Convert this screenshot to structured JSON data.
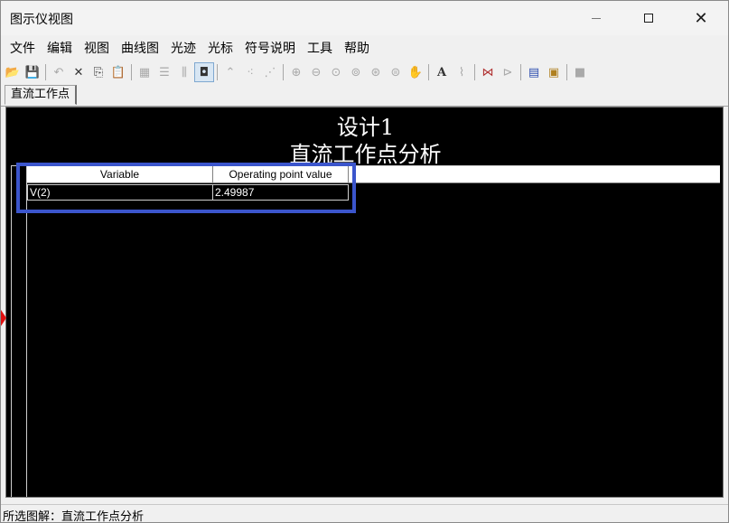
{
  "window": {
    "title": "图示仪视图"
  },
  "menu": [
    "文件",
    "编辑",
    "视图",
    "曲线图",
    "光迹",
    "光标",
    "符号说明",
    "工具",
    "帮助"
  ],
  "toolbar": {
    "buttons": [
      {
        "icon": "open-folder-icon",
        "glyph": "📂"
      },
      {
        "icon": "save-icon",
        "glyph": "💾"
      },
      {
        "icon": "undo-icon",
        "glyph": "↶"
      },
      {
        "icon": "delete-icon",
        "glyph": "✕"
      },
      {
        "icon": "copy-icon",
        "glyph": "⎘"
      },
      {
        "icon": "paste-icon",
        "glyph": "📋"
      },
      {
        "icon": "grid-icon",
        "glyph": "▦"
      },
      {
        "icon": "list-icon",
        "glyph": "☰"
      },
      {
        "icon": "plot-axes-icon",
        "glyph": "⫼"
      },
      {
        "icon": "overlay-icon",
        "glyph": "◘"
      },
      {
        "icon": "trace-line-icon",
        "glyph": "⌃"
      },
      {
        "icon": "trace-points-icon",
        "glyph": "⁖"
      },
      {
        "icon": "trace-marked-icon",
        "glyph": "⋰"
      },
      {
        "icon": "zoom-in-icon",
        "glyph": "⊕"
      },
      {
        "icon": "zoom-out-icon",
        "glyph": "⊖"
      },
      {
        "icon": "zoom-fit-icon",
        "glyph": "⊙"
      },
      {
        "icon": "zoom-x-icon",
        "glyph": "⊚"
      },
      {
        "icon": "zoom-y-icon",
        "glyph": "⊛"
      },
      {
        "icon": "zoom-area-icon",
        "glyph": "⊜"
      },
      {
        "icon": "pan-hand-icon",
        "glyph": "✋"
      },
      {
        "icon": "text-icon",
        "glyph": "A"
      },
      {
        "icon": "cursor-trace-icon",
        "glyph": "⌇"
      },
      {
        "icon": "show-cursors-icon",
        "glyph": "⋈"
      },
      {
        "icon": "cursor-export-icon",
        "glyph": "⊳"
      },
      {
        "icon": "export-data-icon",
        "glyph": "▤"
      },
      {
        "icon": "export-image-icon",
        "glyph": "▣"
      },
      {
        "icon": "stop-icon",
        "glyph": "■"
      }
    ]
  },
  "tabs": [
    {
      "label": "直流工作点"
    }
  ],
  "plot": {
    "title_line1": "设计1",
    "title_line2": "直流工作点分析",
    "table": {
      "headers": [
        "Variable",
        "Operating point value"
      ],
      "rows": [
        [
          "V(2)",
          "2.49987"
        ]
      ]
    }
  },
  "status": {
    "text": "所选图解：直流工作点分析"
  },
  "colors": {
    "plot_background": "#000000",
    "highlight": "#3b55cc",
    "marker": "#e01010"
  }
}
